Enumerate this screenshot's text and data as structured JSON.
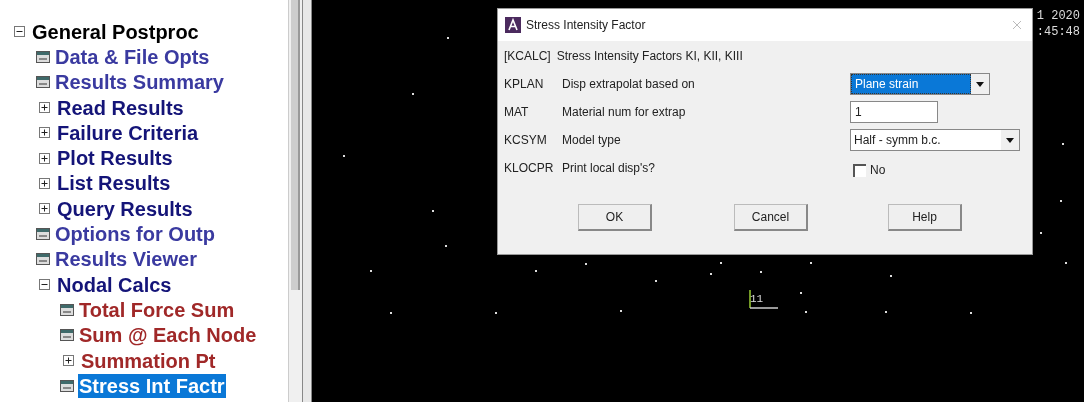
{
  "tree": {
    "label": "General Postproc",
    "kind": "folder",
    "expanded": true,
    "children": [
      {
        "label": "Data & File Opts",
        "kind": "dialog"
      },
      {
        "label": "Results Summary",
        "kind": "dialog"
      },
      {
        "label": "Read Results",
        "kind": "folder",
        "expanded": false
      },
      {
        "label": "Failure Criteria",
        "kind": "folder",
        "expanded": false
      },
      {
        "label": "Plot Results",
        "kind": "folder",
        "expanded": false
      },
      {
        "label": "List Results",
        "kind": "folder",
        "expanded": false
      },
      {
        "label": "Query Results",
        "kind": "folder",
        "expanded": false
      },
      {
        "label": "Options for Outp",
        "kind": "dialog"
      },
      {
        "label": "Results Viewer",
        "kind": "dialog"
      },
      {
        "label": "Nodal Calcs",
        "kind": "folder",
        "expanded": true,
        "children": [
          {
            "label": "Total Force Sum",
            "kind": "dialog",
            "selected": false
          },
          {
            "label": "Sum @ Each Node",
            "kind": "dialog",
            "selected": false
          },
          {
            "label": "Summation Pt",
            "kind": "folder",
            "expanded": false,
            "selected": false
          },
          {
            "label": "Stress Int Factr",
            "kind": "dialog",
            "selected": true
          }
        ]
      }
    ]
  },
  "graphics": {
    "date": "1 2020",
    "time": ":45:48",
    "node_label": "11"
  },
  "dialog": {
    "title": "Stress Intensity Factor",
    "rows": [
      {
        "kind": "header",
        "code": "[KCALC]",
        "label": "Stress Intensity Factors KI, KII, KIII"
      },
      {
        "kind": "select",
        "code": "KPLAN",
        "label": "Disp extrapolat based on",
        "value": "Plane strain",
        "focused": true
      },
      {
        "kind": "input",
        "code": "MAT",
        "label": "Material num for extrap",
        "value": "1"
      },
      {
        "kind": "select",
        "code": "KCSYM",
        "label": "Model type",
        "value": "Half - symm b.c.",
        "focused": false
      },
      {
        "kind": "checkbox",
        "code": "KLOCPR",
        "label": "Print local disp's?",
        "value": "No",
        "checked": false
      }
    ],
    "buttons": [
      "OK",
      "Cancel",
      "Help"
    ]
  }
}
